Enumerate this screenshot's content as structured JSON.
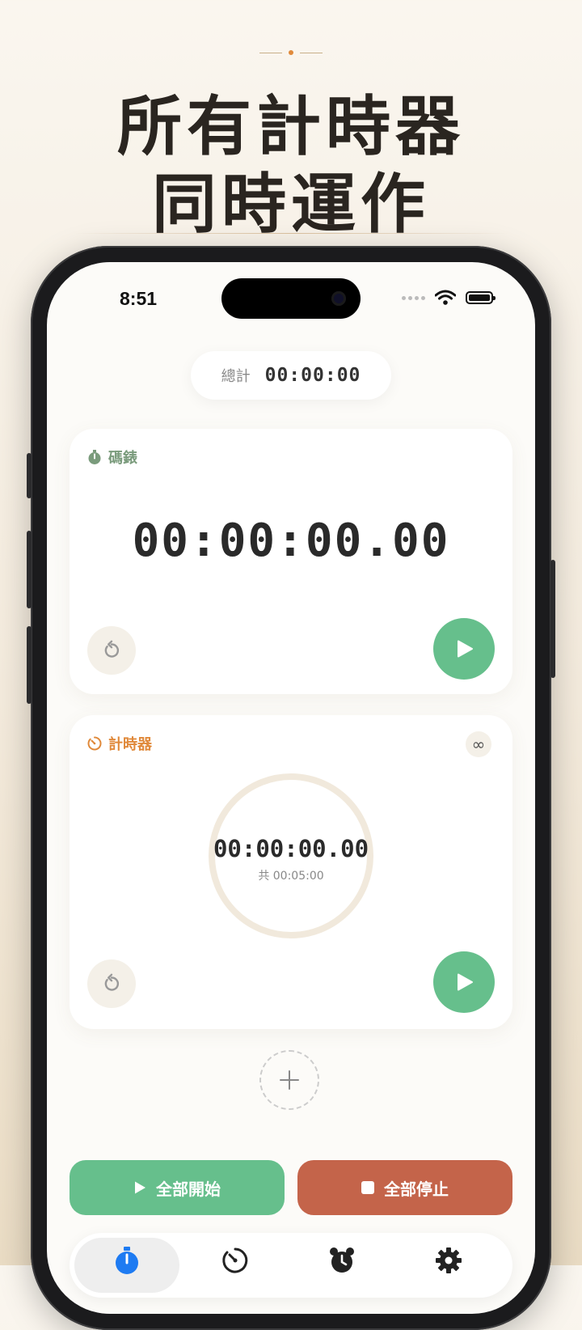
{
  "headline": {
    "line1": "所有計時器",
    "line2": "同時運作"
  },
  "status_bar": {
    "time": "8:51"
  },
  "total": {
    "label": "總計",
    "value": "00:00:00"
  },
  "stopwatch_card": {
    "label": "碼錶",
    "time": "00:00:00.00"
  },
  "timer_card": {
    "label": "計時器",
    "time": "00:00:00.00",
    "total": "共 00:05:00",
    "progress": 0
  },
  "actions": {
    "start_all": "全部開始",
    "stop_all": "全部停止"
  },
  "tabs": [
    {
      "icon": "stopwatch-icon",
      "selected": true
    },
    {
      "icon": "timer-icon",
      "selected": false
    },
    {
      "icon": "alarm-clock-icon",
      "selected": false
    },
    {
      "icon": "gear-icon",
      "selected": false
    }
  ],
  "colors": {
    "accent_green": "#66bf8c",
    "accent_orange": "#e0893a",
    "stop_red": "#c4644a",
    "selected_tab_blue": "#1e7bf2"
  }
}
